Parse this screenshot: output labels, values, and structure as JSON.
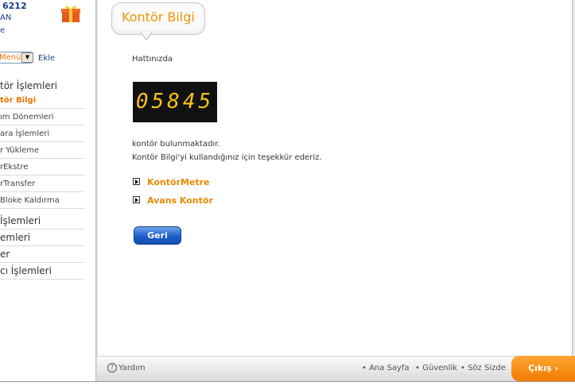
{
  "sidebar": {
    "phone_number": "6212",
    "phone_sub": "AN",
    "phone_link": "e",
    "menu_select_value": "Menü",
    "add_label": "Ekle",
    "section_title": "tör İşlemleri",
    "items": [
      {
        "label": "tör Bilgi",
        "active": true
      },
      {
        "label": "ım Dönemleri"
      },
      {
        "label": "ara İşlemleri"
      },
      {
        "label": "r Yükleme"
      },
      {
        "label": "rEkstre"
      },
      {
        "label": "rTransfer"
      },
      {
        "label": "Bloke Kaldırma"
      }
    ],
    "groups": [
      {
        "label": "İşlemleri"
      },
      {
        "label": "emleri"
      },
      {
        "label": "er"
      },
      {
        "label": "cı İşlemleri"
      }
    ]
  },
  "main": {
    "title": "Kontör Bilgi",
    "line_label": "Hattınızda",
    "counter_value": "05845",
    "text_1": "kontör bulunmaktadır.",
    "text_2": "Kontör Bilgi'yi kullandığınız için teşekkür ederiz.",
    "links": [
      {
        "label": "KontörMetre"
      },
      {
        "label": "Avans Kontör"
      }
    ],
    "back_label": "Geri"
  },
  "footer": {
    "help_label": "Yardım",
    "links": [
      "Ana Sayfa",
      "Güvenlik",
      "Söz Sizde"
    ],
    "exit_label": "Çıkış"
  },
  "colors": {
    "accent_orange": "#f39200",
    "nav_blue": "#1a3b8c",
    "button_blue": "#1b5fc8",
    "counter_digits": "#f7c21a"
  }
}
